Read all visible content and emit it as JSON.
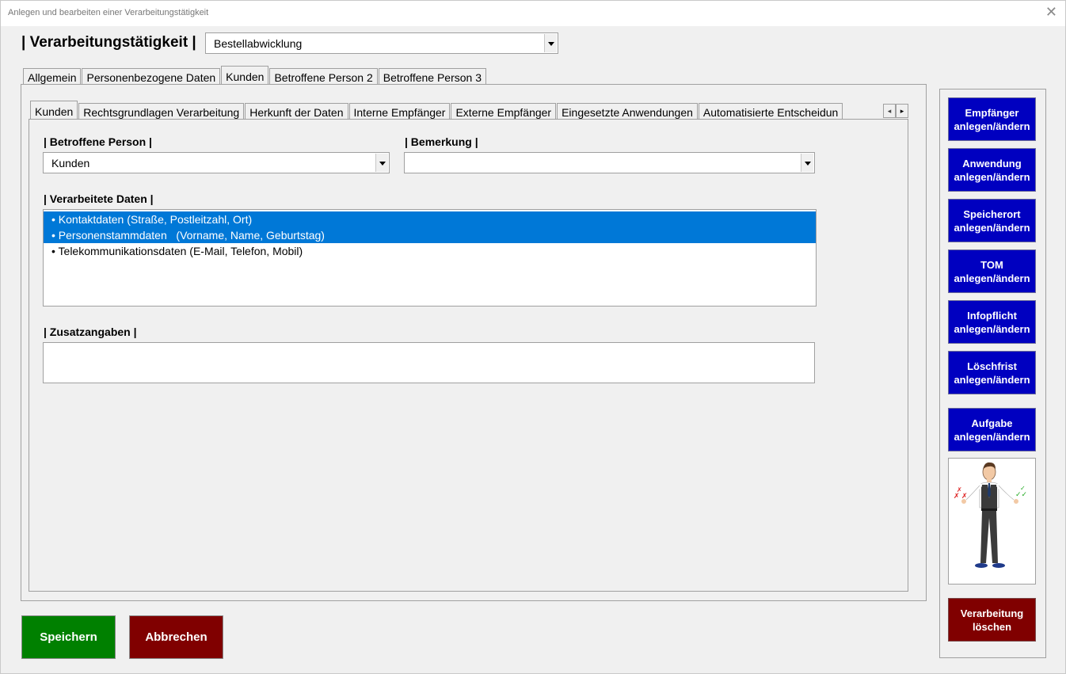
{
  "window": {
    "title": "Anlegen und bearbeiten einer Verarbeitungstätigkeit",
    "close_glyph": "✕"
  },
  "header": {
    "label": "| Verarbeitungstätigkeit |",
    "selected": "Bestellabwicklung"
  },
  "main_tabs": [
    "Allgemein",
    "Personenbezogene Daten",
    "Kunden",
    "Betroffene Person 2",
    "Betroffene Person 3"
  ],
  "main_tab_active": "Kunden",
  "sub_tabs": [
    "Kunden",
    "Rechtsgrundlagen Verarbeitung",
    "Herkunft der Daten",
    "Interne Empfänger",
    "Externe Empfänger",
    "Eingesetzte Anwendungen",
    "Automatisierte Entscheidun"
  ],
  "sub_tab_active": "Kunden",
  "fields": {
    "betroffene_label": "| Betroffene Person |",
    "betroffene_value": "Kunden",
    "bemerkung_label": "| Bemerkung |",
    "bemerkung_value": "",
    "verarbeitete_label": "| Verarbeitete Daten |",
    "verarbeitete_items": [
      {
        "text": "• Kontaktdaten (Straße, Postleitzahl, Ort)",
        "selected": true
      },
      {
        "text": "• Personenstammdaten   (Vorname, Name, Geburtstag)",
        "selected": true
      },
      {
        "text": "• Telekommunikationsdaten (E-Mail, Telefon, Mobil)",
        "selected": false
      }
    ],
    "zusatz_label": "| Zusatzangaben |",
    "zusatz_value": ""
  },
  "side_buttons": [
    {
      "line1": "Empfänger",
      "line2": "anlegen/ändern"
    },
    {
      "line1": "Anwendung",
      "line2": "anlegen/ändern"
    },
    {
      "line1": "Speicherort",
      "line2": "anlegen/ändern"
    },
    {
      "line1": "TOM",
      "line2": "anlegen/ändern"
    },
    {
      "line1": "Infopflicht",
      "line2": "anlegen/ändern"
    },
    {
      "line1": "Löschfrist",
      "line2": "anlegen/ändern"
    },
    {
      "line1": "Aufgabe",
      "line2": "anlegen/ändern"
    }
  ],
  "delete_button": {
    "line1": "Verarbeitung",
    "line2": "löschen"
  },
  "footer": {
    "save": "Speichern",
    "cancel": "Abbrechen"
  },
  "colors": {
    "blue_button": "#0000c0",
    "save_green": "#008000",
    "dark_red": "#800000",
    "selection": "#0078d7"
  },
  "icons": {
    "figure": "businessman-illustration",
    "scroll_left": "◂",
    "scroll_right": "▸"
  }
}
